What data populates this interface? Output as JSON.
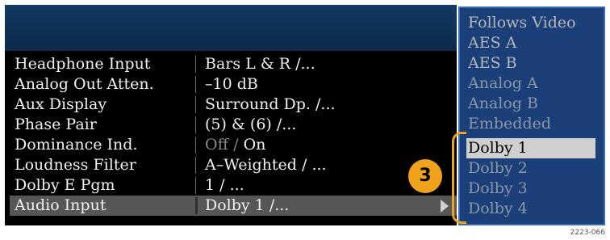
{
  "settings": [
    {
      "label": "Headphone Input",
      "value": "Bars L & R /..."
    },
    {
      "label": "Analog Out Atten.",
      "value": "–10 dB"
    },
    {
      "label": "Aux Display",
      "value": "Surround Dp. /..."
    },
    {
      "label": "Phase Pair",
      "value": "(5) & (6) /..."
    },
    {
      "label": "Dominance Ind.",
      "value_off": "Off",
      "value_sep": " / ",
      "value_on": "On"
    },
    {
      "label": "Loudness Filter",
      "value": "A–Weighted / ..."
    },
    {
      "label": "Dolby E Pgm",
      "value": "1 / ..."
    },
    {
      "label": "Audio Input",
      "value": "Dolby 1 /..."
    }
  ],
  "menu": {
    "items": [
      "Follows Video",
      "AES A",
      "AES B",
      "Analog A",
      "Analog B",
      "Embedded",
      "Dolby 1",
      "Dolby 2",
      "Dolby 3",
      "Dolby 4"
    ],
    "selected": "Dolby 1"
  },
  "callout": {
    "number": "3"
  },
  "figure_id": "2223-066",
  "colors": {
    "callout": "#f1a21b",
    "menu_bg": "#1b3f79",
    "title_bar": "#0c2a4b"
  }
}
